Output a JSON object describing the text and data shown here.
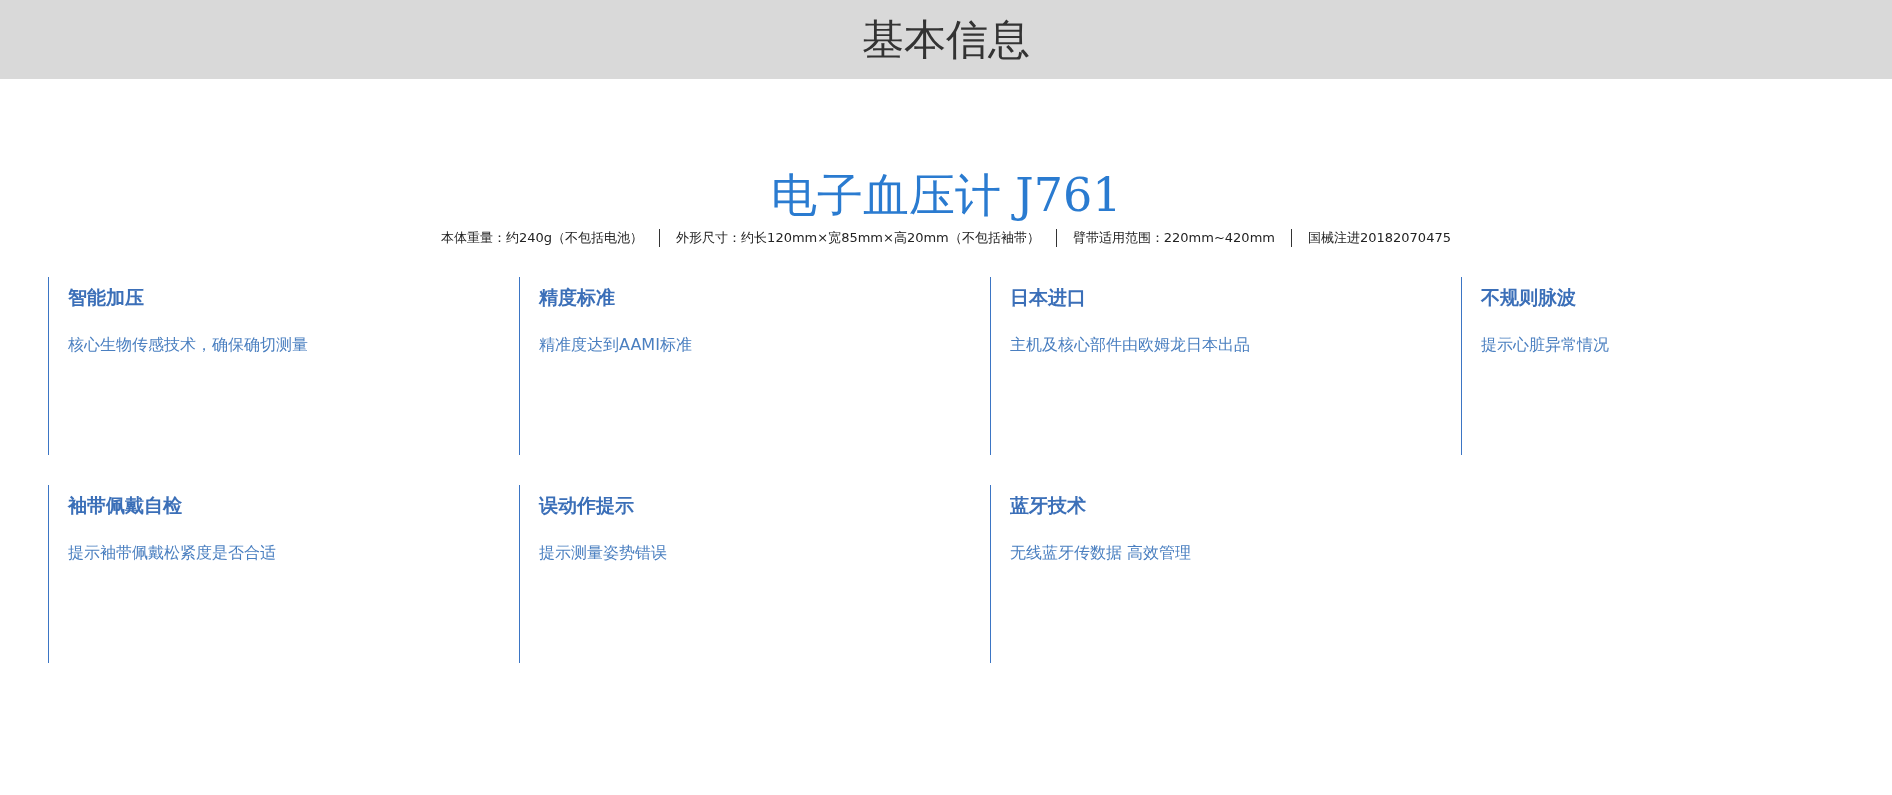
{
  "header": {
    "title": "基本信息"
  },
  "product": {
    "name": "电子血压计 J761",
    "specs": [
      "本体重量：约240g（不包括电池）",
      "外形尺寸：约长120mm×宽85mm×高20mm（不包括袖带）",
      "臂带适用范围：220mm~420mm",
      "国械注进20182070475"
    ]
  },
  "features": [
    {
      "title": "智能加压",
      "description": "核心生物传感技术，确保确切测量"
    },
    {
      "title": "精度标准",
      "description": "精准度达到AAMI标准"
    },
    {
      "title": "日本进口",
      "description": "主机及核心部件由欧姆龙日本出品"
    },
    {
      "title": "不规则脉波",
      "description": "提示心脏异常情况"
    },
    {
      "title": "袖带佩戴自检",
      "description": "提示袖带佩戴松紧度是否合适"
    },
    {
      "title": "误动作提示",
      "description": "提示测量姿势错误"
    },
    {
      "title": "蓝牙技术",
      "description": "无线蓝牙传数据 高效管理"
    }
  ]
}
